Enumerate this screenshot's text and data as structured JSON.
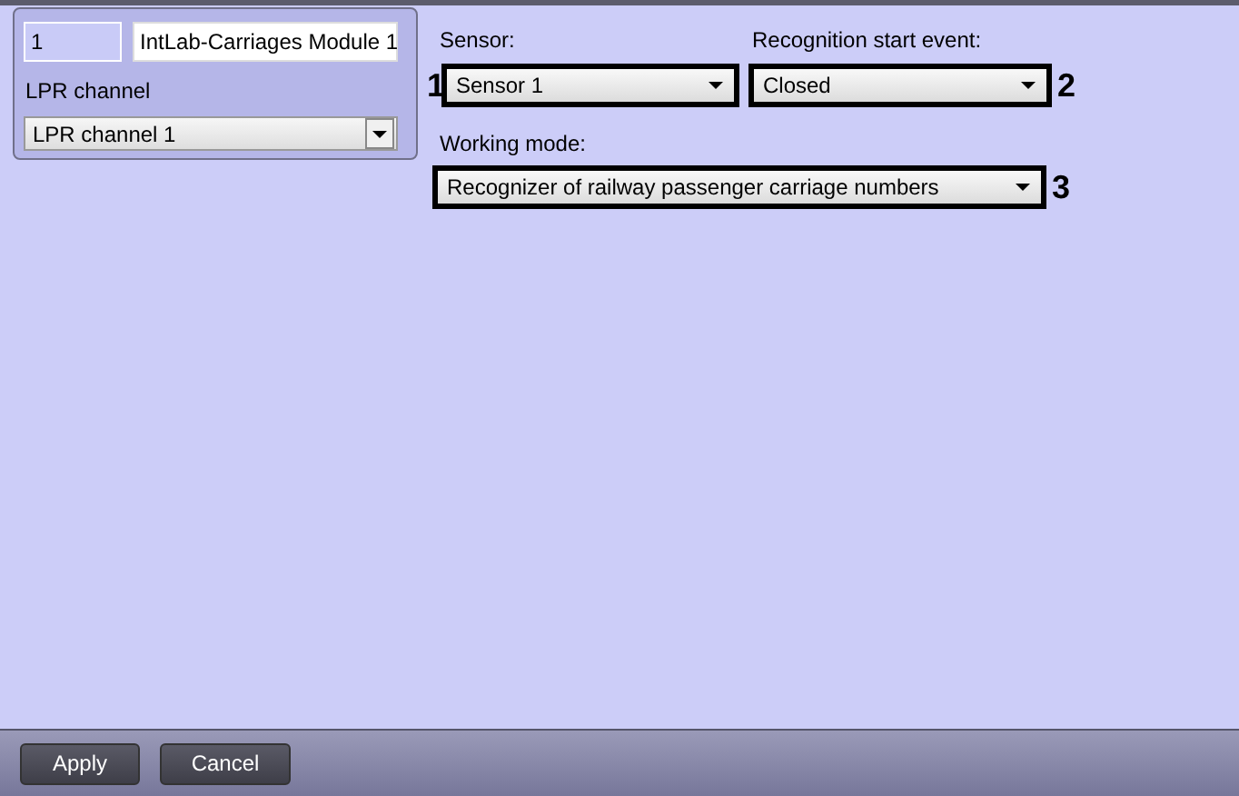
{
  "module": {
    "id": "1",
    "name": "IntLab-Carriages Module 1",
    "channel_label": "LPR channel",
    "channel": "LPR channel 1"
  },
  "fields": [
    {
      "label": "Sensor:",
      "value": "Sensor 1",
      "callout": "1"
    },
    {
      "label": "Recognition start event:",
      "value": "Closed",
      "callout": "2"
    },
    {
      "label": "Working mode:",
      "value": "Recognizer of railway passenger carriage numbers",
      "callout": "3"
    }
  ],
  "buttons": [
    "Apply",
    "Cancel"
  ]
}
